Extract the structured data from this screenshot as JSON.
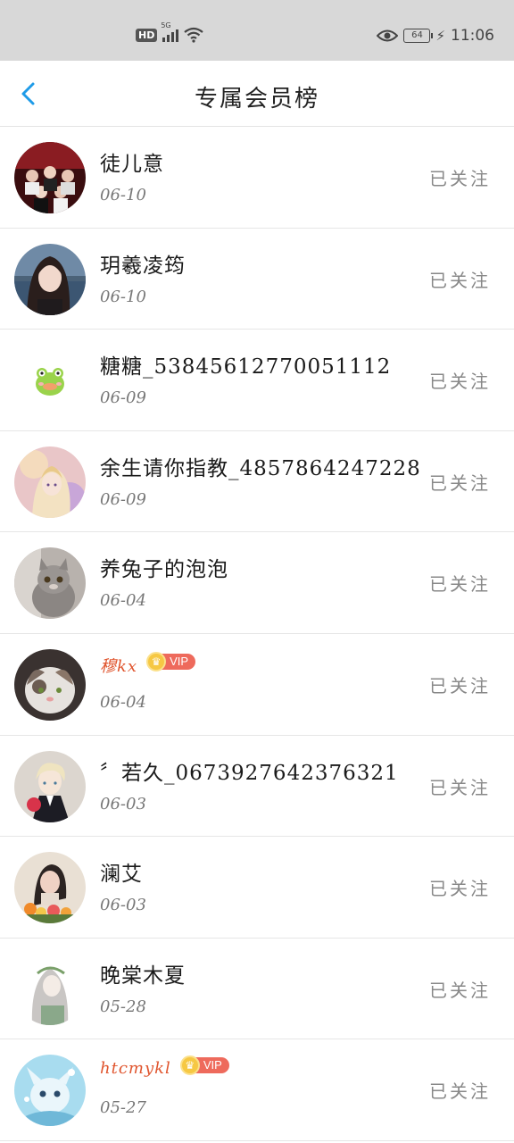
{
  "status_bar": {
    "hd": "HD",
    "network": "5G",
    "battery": "64",
    "time": "11:06"
  },
  "header": {
    "title": "专属会员榜"
  },
  "members": [
    {
      "name": "徒儿意",
      "date": "06-10",
      "follow": "已关注",
      "vip": false,
      "avatar": "group-photo"
    },
    {
      "name": "玥羲凌筠",
      "date": "06-10",
      "follow": "已关注",
      "vip": false,
      "avatar": "girl-by-sea"
    },
    {
      "name": "糖糖_5384561277005111​2",
      "date": "06-09",
      "follow": "已关注",
      "vip": false,
      "avatar": "green-frog"
    },
    {
      "name": "余生请你指教_4857864247228",
      "date": "06-09",
      "follow": "已关注",
      "vip": false,
      "avatar": "anime-girl"
    },
    {
      "name": "养兔子的泡泡",
      "date": "06-04",
      "follow": "已关注",
      "vip": false,
      "avatar": "grey-cat"
    },
    {
      "name": "穆kx",
      "date": "06-04",
      "follow": "已关注",
      "vip": true,
      "vip_label": "VIP",
      "avatar": "white-cat"
    },
    {
      "name": "〞若久_0673927642376321",
      "date": "06-03",
      "follow": "已关注",
      "vip": false,
      "avatar": "anime-boy"
    },
    {
      "name": "澜艾",
      "date": "06-03",
      "follow": "已关注",
      "vip": false,
      "avatar": "woman-flowers"
    },
    {
      "name": "晚棠木夏",
      "date": "05-28",
      "follow": "已关注",
      "vip": false,
      "avatar": "sketch-girl"
    },
    {
      "name": "htcmykl",
      "date": "05-27",
      "follow": "已关注",
      "vip": true,
      "vip_label": "VIP",
      "avatar": "blue-creature"
    }
  ]
}
